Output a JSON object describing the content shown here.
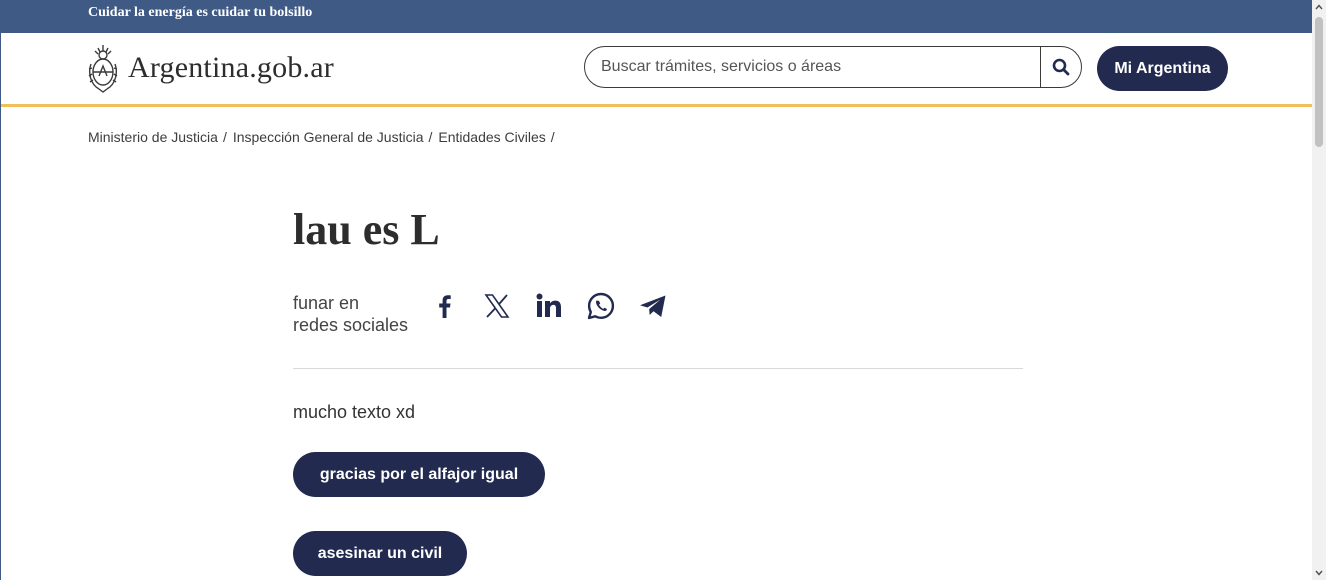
{
  "topbar": {
    "text": "Cuidar la energía es cuidar tu bolsillo"
  },
  "header": {
    "brand": "Argentina.gob.ar",
    "search_placeholder": "Buscar trámites, servicios o áreas",
    "search_value": "",
    "mi_argentina": "Mi Argentina"
  },
  "breadcrumb": [
    {
      "label": "Ministerio de Justicia"
    },
    {
      "label": "Inspección General de Justicia"
    },
    {
      "label": "Entidades Civiles"
    }
  ],
  "breadcrumb_sep": "/",
  "main": {
    "title": "lau es L",
    "share_line1": "funar en",
    "share_line2": "redes sociales",
    "share_icons": [
      "facebook-icon",
      "x-icon",
      "linkedin-icon",
      "whatsapp-icon",
      "telegram-icon"
    ],
    "body": "mucho texto xd",
    "button1": "gracias por el alfajor igual",
    "button2": "asesinar un civil"
  },
  "colors": {
    "topbar": "#3e5a85",
    "accent_line": "#f0c15b",
    "button": "#222a4f"
  }
}
